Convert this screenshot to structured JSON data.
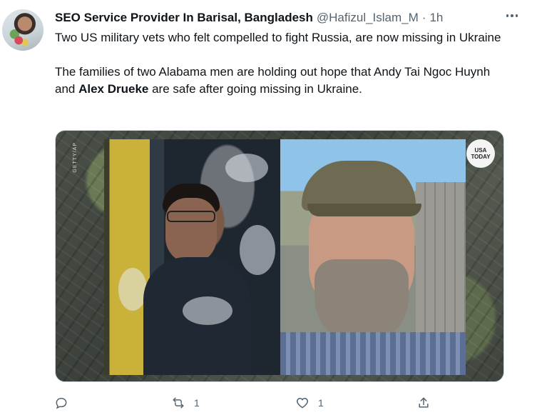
{
  "tweet": {
    "author_name": "SEO Service Provider In Barisal, Bangladesh",
    "handle": "@Hafizul_Islam_M",
    "separator": "·",
    "time": "1h",
    "paragraph1": "Two US military vets who felt compelled to fight Russia, are now missing in Ukraine",
    "paragraph2_part1": "The families of two Alabama men are holding out hope that Andy Tai Ngoc Huynh and ",
    "paragraph2_bold": "Alex Drueke",
    "paragraph2_part2": " are safe after going missing in Ukraine.",
    "media": {
      "watermark": "GETTY/AP",
      "badge_line1": "USA",
      "badge_line2": "TODAY"
    },
    "actions": {
      "reply_icon": "reply-icon",
      "retweet_icon": "retweet-icon",
      "retweet_count": "1",
      "like_icon": "heart-icon",
      "like_count": "1",
      "share_icon": "share-icon"
    }
  },
  "colors": {
    "text": "#0f1419",
    "secondary": "#536471",
    "border": "#cfd9de"
  }
}
